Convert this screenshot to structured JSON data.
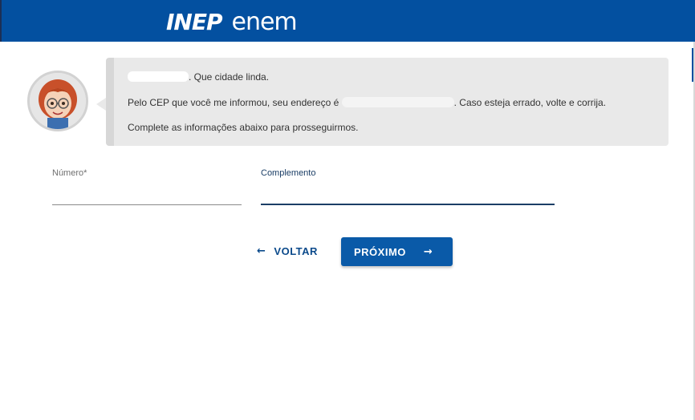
{
  "header": {
    "logo_inep": "INEP",
    "logo_enem": "enem",
    "color": "#0350a0"
  },
  "assistant": {
    "avatar_icon": "avatar-woman-glasses-icon",
    "line1_suffix": ". Que cidade linda.",
    "line2_prefix": "Pelo CEP que você me informou, seu endereço é",
    "line2_suffix": ". Caso esteja errado, volte e corrija.",
    "line3": "Complete as informações abaixo para prosseguirmos."
  },
  "form": {
    "numero_label": "Número",
    "required_marker": "*",
    "numero_value": "",
    "complemento_label": "Complemento",
    "complemento_value": ""
  },
  "actions": {
    "back_label": "VOLTAR",
    "back_icon": "arrow-left-icon",
    "next_label": "PRÓXIMO",
    "next_icon": "arrow-right-icon"
  }
}
